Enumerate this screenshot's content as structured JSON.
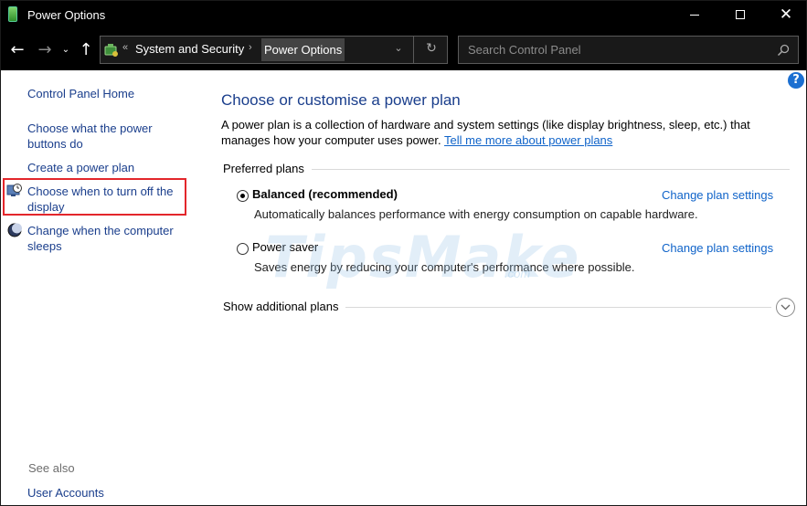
{
  "window": {
    "title": "Power Options",
    "icon": "power-battery-icon",
    "controls": [
      "minimize-icon",
      "maximize-icon",
      "close-icon"
    ],
    "close_glyph": "✕"
  },
  "nav": {
    "back_glyph": "←",
    "forward_glyph": "→",
    "recent_glyph": "⌄",
    "up_glyph": "↑",
    "address": {
      "prefix": "«",
      "crumbs": [
        "System and Security",
        "Power Options"
      ],
      "separator": "›",
      "dropdown_glyph": "⌄",
      "refresh_glyph": "↻"
    },
    "search": {
      "placeholder": "Search Control Panel"
    }
  },
  "help_glyph": "?",
  "sidebar": {
    "home": "Control Panel Home",
    "items": [
      {
        "label": "Choose what the power buttons do"
      },
      {
        "label": "Create a power plan"
      },
      {
        "label": "Choose when to turn off the display",
        "icon": "display-clock-icon",
        "highlighted": true
      },
      {
        "label": "Change when the computer sleeps",
        "icon": "moon-sleep-icon"
      }
    ],
    "see_also": "See also",
    "see_also_links": [
      "User Accounts"
    ]
  },
  "main": {
    "title": "Choose or customise a power plan",
    "description": "A power plan is a collection of hardware and system settings (like display brightness, sleep, etc.) that manages how your computer uses power.",
    "learn_more": "Tell me more about power plans",
    "preferred_heading": "Preferred plans",
    "plans": [
      {
        "name": "Balanced (recommended)",
        "selected": true,
        "description": "Automatically balances performance with energy consumption on capable hardware.",
        "link": "Change plan settings"
      },
      {
        "name": "Power saver",
        "selected": false,
        "description": "Saves energy by reducing your computer's performance where possible.",
        "link": "Change plan settings"
      }
    ],
    "show_additional": "Show additional plans"
  },
  "watermark": {
    "text": "TipsMake",
    "sub": ".com"
  },
  "colors": {
    "titlebar": "#000000",
    "link": "#1a3e8c",
    "accent_link": "#0f63c9",
    "highlight": "#e3262b",
    "help": "#1b6fd1"
  }
}
